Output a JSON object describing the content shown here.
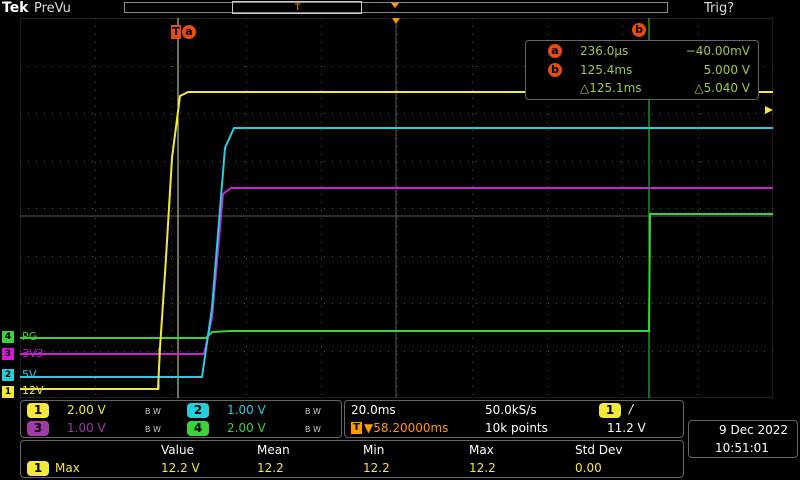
{
  "topbar": {
    "brand": "Tek",
    "mode": "PreVu",
    "trigger_status": "Trig?",
    "record_trigger_marker": "T"
  },
  "cursors": {
    "a": {
      "badge": "a",
      "time": "236.0µs",
      "value": "−40.00mV"
    },
    "b": {
      "badge": "b",
      "time": "125.4ms",
      "value": "5.000 V"
    },
    "delta": {
      "time": "△125.1ms",
      "value": "△5.040 V"
    },
    "marker_a_t": "T",
    "marker_a": "a",
    "marker_b": "b"
  },
  "channels": [
    {
      "num": "1",
      "name": "12V",
      "scale": "2.00 V",
      "color": "#f2e93a"
    },
    {
      "num": "2",
      "name": "5V",
      "scale": "1.00 V",
      "color": "#23d0e0"
    },
    {
      "num": "3",
      "name": "3V3",
      "scale": "1.00 V",
      "color": "#d21bd8"
    },
    {
      "num": "4",
      "name": "PG",
      "scale": "2.00 V",
      "color": "#3cd23c"
    }
  ],
  "bw_label": "B W",
  "timebase": {
    "scale": "20.0ms",
    "sample_rate": "50.0kS/s",
    "trigger_pos": "▼58.20000ms",
    "record_length": "10k points",
    "trigger_marker": "T",
    "trigger_channel": "1",
    "trigger_slope": "/",
    "trigger_level": "11.2 V"
  },
  "datetime": {
    "date": "9 Dec  2022",
    "time": "10:51:01"
  },
  "measurement": {
    "headers": {
      "value": "Value",
      "mean": "Mean",
      "min": "Min",
      "max": "Max",
      "std": "Std Dev"
    },
    "row": {
      "channel": "1",
      "name": "Max",
      "value": "12.2 V",
      "mean": "12.2",
      "min": "12.2",
      "max": "12.2",
      "std": "0.00"
    }
  }
}
